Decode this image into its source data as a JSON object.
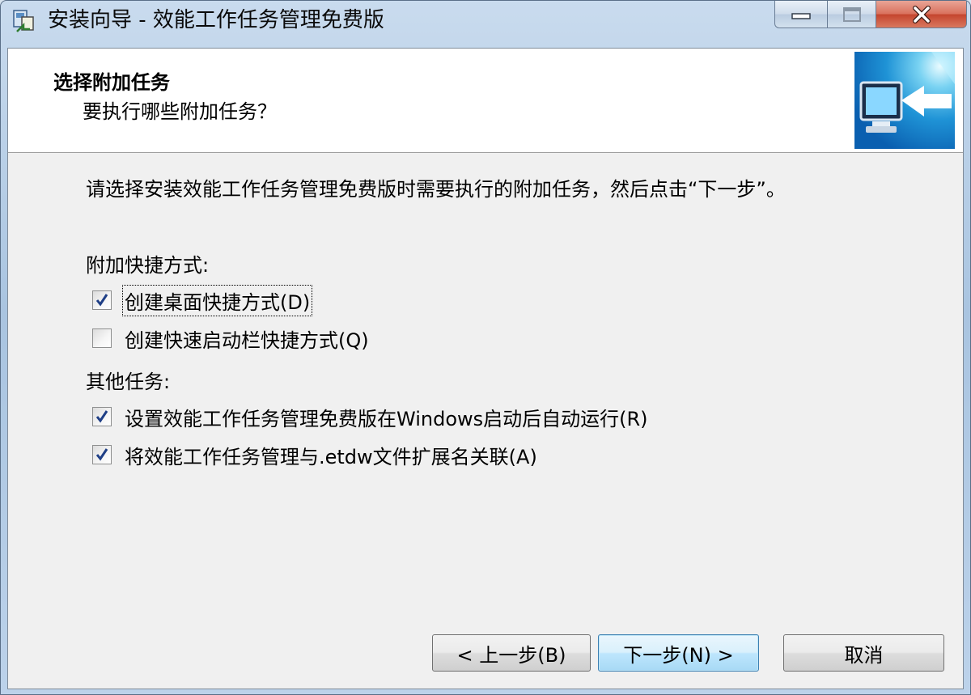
{
  "window": {
    "title": "安装向导 - 效能工作任务管理免费版",
    "icon": "installer-icon"
  },
  "header": {
    "title": "选择附加任务",
    "subtitle": "要执行哪些附加任务？",
    "image": "computer-install-arrow-image"
  },
  "body": {
    "intro": "请选择安装效能工作任务管理免费版时需要执行的附加任务，然后点击“下一步”。",
    "groups": [
      {
        "label": "附加快捷方式:",
        "options": [
          {
            "label": "创建桌面快捷方式(D)",
            "checked": true
          },
          {
            "label": "创建快速启动栏快捷方式(Q)",
            "checked": false
          }
        ]
      },
      {
        "label": "其他任务:",
        "options": [
          {
            "label": "设置效能工作任务管理免费版在Windows启动后自动运行(R)",
            "checked": true
          },
          {
            "label": "将效能工作任务管理与.etdw文件扩展名关联(A)",
            "checked": true
          }
        ]
      }
    ]
  },
  "buttons": {
    "back": "< 上一步(B)",
    "next": "下一步(N) >",
    "cancel": "取消"
  },
  "colors": {
    "client_bg": "#f0f0f0",
    "header_bg": "#ffffff",
    "default_button_border": "#3c7fb1",
    "close_button": "#c4442d"
  }
}
